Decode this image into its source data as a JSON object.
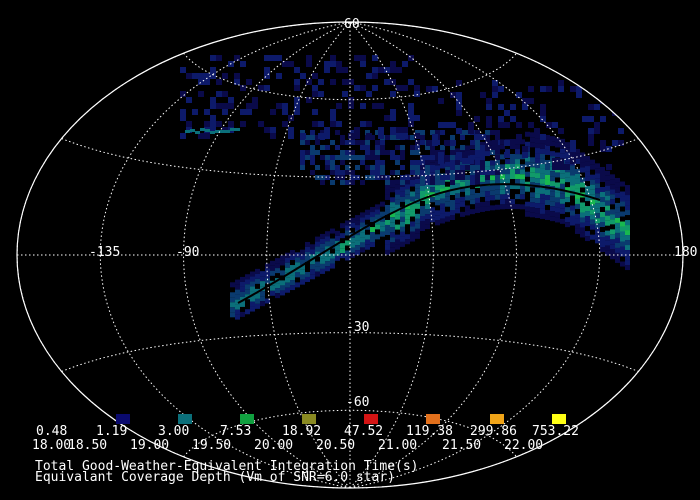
{
  "map": {
    "projection": "aitoff",
    "graticule_color": "#ffffff",
    "background": "#000000",
    "lon_labels": [
      "-135",
      "-90",
      "180"
    ],
    "lat_labels": [
      "-30",
      "-60"
    ],
    "top_label": "60",
    "track_color": "#000000"
  },
  "legend": {
    "swatches": [
      {
        "color": "#000000",
        "time": "0.48",
        "depth": "18.00"
      },
      {
        "color": "#0a0a6e",
        "time": "1.19",
        "depth": "18.50"
      },
      {
        "color": "#0b6f7a",
        "time": "3.00",
        "depth": "19.00"
      },
      {
        "color": "#11a040",
        "time": "7.53",
        "depth": "19.50"
      },
      {
        "color": "#8a8a22",
        "time": "18.92",
        "depth": "20.00"
      },
      {
        "color": "#d41414",
        "time": "47.52",
        "depth": "20.50"
      },
      {
        "color": "#e2701c",
        "time": "119.38",
        "depth": "21.00"
      },
      {
        "color": "#f0a418",
        "time": "299.86",
        "depth": "21.50"
      },
      {
        "color": "#ffff14",
        "time": "753.22",
        "depth": "22.00"
      }
    ],
    "caption_line1": "Total Good-Weather-Equivalent Integration Time(s)",
    "caption_line2": "Equivalant Coverage Depth (Vm of SNR=6.0 star)"
  }
}
